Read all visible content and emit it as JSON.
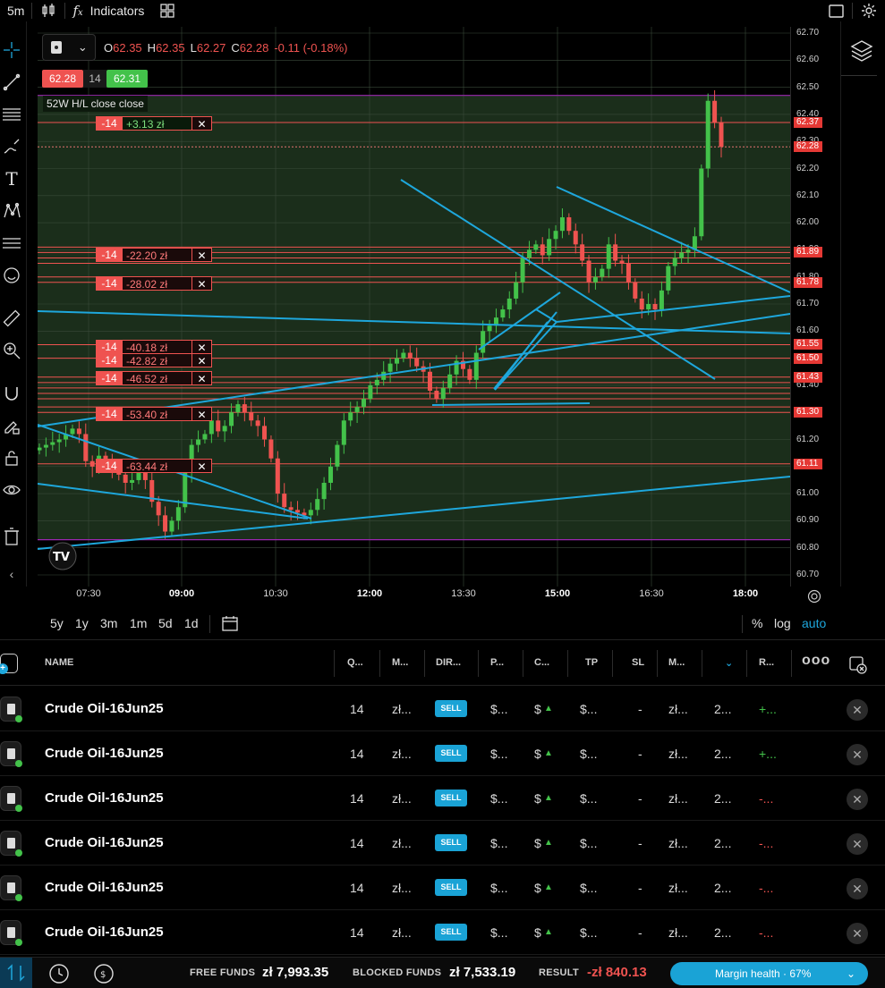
{
  "topbar": {
    "interval": "5m",
    "indicators_label": "Indicators"
  },
  "legend": {
    "o_label": "O",
    "o": "62.35",
    "h_label": "H",
    "h": "62.35",
    "l_label": "L",
    "l": "62.27",
    "c_label": "C",
    "c": "62.28",
    "change": "-0.11 (-0.18%)",
    "bid": "62.28",
    "qty": "14",
    "ask": "62.31"
  },
  "hl_label": "52W H/L close close",
  "order_tags": [
    {
      "qty": "-14",
      "pl": "+3.13 zł",
      "positive": true
    },
    {
      "qty": "-14",
      "pl": "-22.20 zł"
    },
    {
      "qty": "-14",
      "pl": "-28.02 zł"
    },
    {
      "qty": "-14",
      "pl": "-40.18 zł"
    },
    {
      "qty": "-14",
      "pl": "-42.82 zł"
    },
    {
      "qty": "-14",
      "pl": "-46.52 zł"
    },
    {
      "qty": "-14",
      "pl": "-53.40 zł"
    },
    {
      "qty": "-14",
      "pl": "-63.44 zł"
    }
  ],
  "price_axis": [
    "62.70",
    "62.60",
    "62.50",
    "62.40",
    "62.30",
    "62.20",
    "62.10",
    "62.00",
    "61.90",
    "61.80",
    "61.70",
    "61.60",
    "61.50",
    "61.40",
    "61.30",
    "61.20",
    "61.10",
    "61.00",
    "60.90",
    "60.80",
    "60.70"
  ],
  "price_tags": [
    "62.37",
    "62.28",
    "61.89",
    "61.78",
    "61.55",
    "61.50",
    "61.43",
    "61.30",
    "61.11"
  ],
  "time_axis": [
    {
      "label": "07:30",
      "bold": false
    },
    {
      "label": "09:00",
      "bold": true
    },
    {
      "label": "10:30",
      "bold": false
    },
    {
      "label": "12:00",
      "bold": true
    },
    {
      "label": "13:30",
      "bold": false
    },
    {
      "label": "15:00",
      "bold": true
    },
    {
      "label": "16:30",
      "bold": false
    },
    {
      "label": "18:00",
      "bold": true
    }
  ],
  "range_bar": {
    "ranges": [
      "5y",
      "1y",
      "3m",
      "1m",
      "5d",
      "1d"
    ],
    "percent": "%",
    "log": "log",
    "auto": "auto"
  },
  "positions": {
    "headers": [
      "NAME",
      "Q...",
      "M...",
      "DIR...",
      "P...",
      "C...",
      "TP",
      "SL",
      "M...",
      "R..."
    ],
    "rows": [
      {
        "name": "Crude Oil-16Jun25",
        "qty": "14",
        "margin": "zł...",
        "dir": "SELL",
        "price": "$...",
        "cur": "$",
        "tp": "$...",
        "sl": "-",
        "m": "zł...",
        "r": "2...",
        "res": "+...",
        "res_positive": true
      },
      {
        "name": "Crude Oil-16Jun25",
        "qty": "14",
        "margin": "zł...",
        "dir": "SELL",
        "price": "$...",
        "cur": "$",
        "tp": "$...",
        "sl": "-",
        "m": "zł...",
        "r": "2...",
        "res": "+...",
        "res_positive": true
      },
      {
        "name": "Crude Oil-16Jun25",
        "qty": "14",
        "margin": "zł...",
        "dir": "SELL",
        "price": "$...",
        "cur": "$",
        "tp": "$...",
        "sl": "-",
        "m": "zł...",
        "r": "2...",
        "res": "-...",
        "res_positive": false
      },
      {
        "name": "Crude Oil-16Jun25",
        "qty": "14",
        "margin": "zł...",
        "dir": "SELL",
        "price": "$...",
        "cur": "$",
        "tp": "$...",
        "sl": "-",
        "m": "zł...",
        "r": "2...",
        "res": "-...",
        "res_positive": false
      },
      {
        "name": "Crude Oil-16Jun25",
        "qty": "14",
        "margin": "zł...",
        "dir": "SELL",
        "price": "$...",
        "cur": "$",
        "tp": "$...",
        "sl": "-",
        "m": "zł...",
        "r": "2...",
        "res": "-...",
        "res_positive": false
      },
      {
        "name": "Crude Oil-16Jun25",
        "qty": "14",
        "margin": "zł...",
        "dir": "SELL",
        "price": "$...",
        "cur": "$",
        "tp": "$...",
        "sl": "-",
        "m": "zł...",
        "r": "2...",
        "res": "-...",
        "res_positive": false
      }
    ]
  },
  "footer": {
    "free_funds_label": "FREE FUNDS",
    "free_funds": "zł 7,993.35",
    "blocked_funds_label": "BLOCKED FUNDS",
    "blocked_funds": "zł 7,533.19",
    "result_label": "RESULT",
    "result": "-zł 840.13",
    "margin_health": "Margin health · 67%"
  },
  "colors": {
    "up": "#43c24a",
    "down": "#ef5350",
    "accent": "#1aa3d6",
    "chart_bg": "#1b2e1b",
    "trendline": "#1ea7dc",
    "order_line": "#ef5350",
    "hl_line": "#9c27b0"
  },
  "chart_data": {
    "type": "candlestick",
    "interval": "5m",
    "ylim": [
      60.7,
      62.7
    ],
    "closes": [
      61.17,
      61.18,
      61.19,
      61.2,
      61.22,
      61.24,
      61.22,
      61.12,
      61.1,
      61.14,
      61.12,
      61.09,
      61.07,
      61.04,
      61.05,
      61.08,
      61.05,
      60.97,
      60.92,
      60.86,
      60.9,
      60.95,
      61.08,
      61.18,
      61.2,
      61.22,
      61.27,
      61.23,
      61.25,
      61.3,
      61.33,
      61.3,
      61.27,
      61.25,
      61.2,
      61.13,
      61.0,
      60.95,
      60.94,
      60.93,
      60.92,
      60.94,
      60.98,
      61.04,
      61.1,
      61.18,
      61.27,
      61.3,
      61.32,
      61.35,
      61.4,
      61.42,
      61.45,
      61.48,
      61.5,
      61.52,
      61.5,
      61.47,
      61.45,
      61.38,
      61.35,
      61.39,
      61.44,
      61.49,
      61.46,
      61.42,
      61.52,
      61.6,
      61.62,
      61.65,
      61.68,
      61.72,
      61.78,
      61.87,
      61.9,
      61.92,
      61.88,
      61.94,
      61.97,
      62.02,
      61.97,
      61.92,
      61.86,
      61.78,
      61.8,
      61.83,
      61.92,
      61.86,
      61.85,
      61.78,
      61.72,
      61.68,
      61.7,
      61.68,
      61.75,
      61.84,
      61.87,
      61.89,
      61.9,
      61.95,
      62.2,
      62.45,
      62.37,
      62.28
    ]
  }
}
